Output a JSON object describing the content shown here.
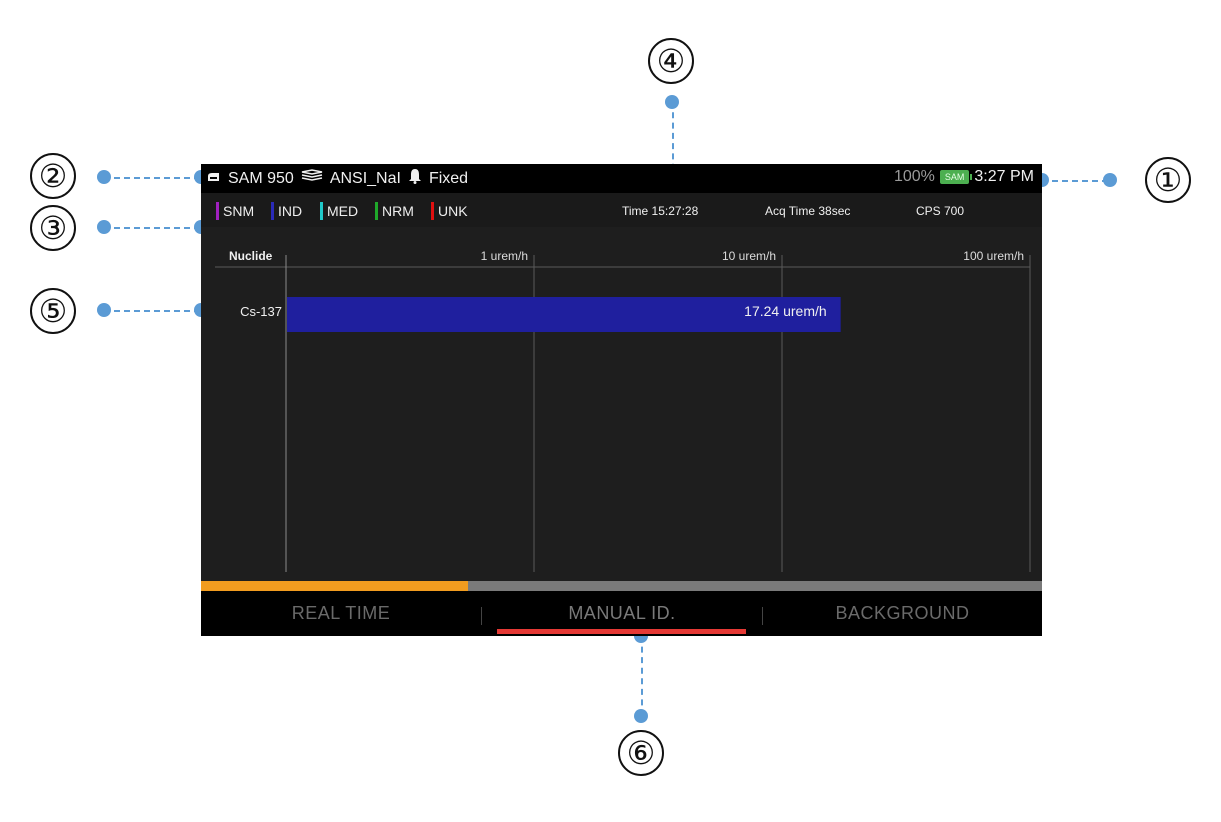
{
  "status_bar": {
    "device_name": "SAM 950",
    "library": "ANSI_NaI",
    "alarm_mode": "Fixed",
    "battery_percent": "100%",
    "battery_label": "SAM",
    "clock": "3:27 PM"
  },
  "legend": [
    {
      "label": "SNM",
      "color": "#a020c0"
    },
    {
      "label": "IND",
      "color": "#2a2ab8"
    },
    {
      "label": "MED",
      "color": "#20c8c8"
    },
    {
      "label": "NRM",
      "color": "#1fa82a"
    },
    {
      "label": "UNK",
      "color": "#e01010"
    }
  ],
  "info": {
    "time": "Time 15:27:28",
    "acq_time": "Acq Time 38sec",
    "cps": "CPS 700"
  },
  "chart_data": {
    "type": "bar",
    "orientation": "horizontal",
    "scale": "log",
    "column_header": "Nuclide",
    "tick_labels": [
      "1 urem/h",
      "10 urem/h",
      "100 urem/h"
    ],
    "tick_values": [
      1,
      10,
      100
    ],
    "xlim": [
      0.1,
      100
    ],
    "bars": [
      {
        "category": "Cs-137",
        "value": 17.24,
        "label": "17.24 urem/h",
        "color": "#1f1f9e"
      }
    ]
  },
  "progress": {
    "fraction": 0.318
  },
  "tabs": [
    {
      "label": "REAL TIME",
      "active": false
    },
    {
      "label": "MANUAL ID.",
      "active": true
    },
    {
      "label": "BACKGROUND",
      "active": false
    }
  ],
  "callouts": [
    "①",
    "②",
    "③",
    "④",
    "⑤",
    "⑥"
  ]
}
